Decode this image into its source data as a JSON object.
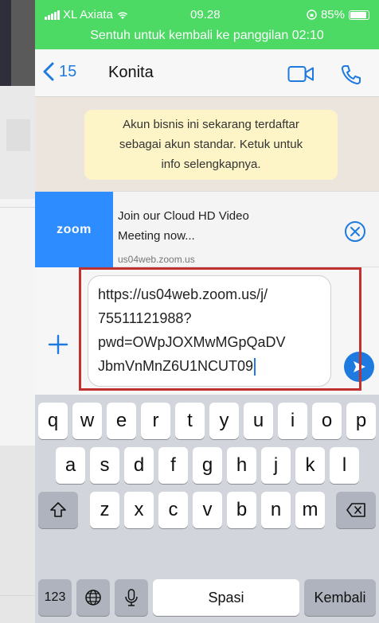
{
  "status_bar": {
    "carrier": "XL Axiata",
    "time": "09.28",
    "battery": "85%",
    "return_banner": "Sentuh untuk kembali ke panggilan 02:10"
  },
  "header": {
    "back_count": "15",
    "contact_name": "Konita",
    "icons": [
      "chevron-left-icon",
      "video-call-icon",
      "phone-call-icon"
    ]
  },
  "chat": {
    "system_message_lines": [
      "Akun bisnis ini sekarang terdaftar",
      "sebagai akun standar. Ketuk untuk",
      "info selengkapnya."
    ]
  },
  "link_preview": {
    "logo_text": "zoom",
    "title_lines": [
      "Join our Cloud HD Video",
      "Meeting now..."
    ],
    "url": "us04web.zoom.us"
  },
  "composer": {
    "text": "https://us04web.zoom.us/j/\n75511121988?\npwd=OWpJOXMwMGpQaDV\nJbmVnMnZ6U1NCUT09"
  },
  "keyboard": {
    "row1": [
      "q",
      "w",
      "e",
      "r",
      "t",
      "y",
      "u",
      "i",
      "o",
      "p"
    ],
    "row2": [
      "a",
      "s",
      "d",
      "f",
      "g",
      "h",
      "j",
      "k",
      "l"
    ],
    "row3": [
      "z",
      "x",
      "c",
      "v",
      "b",
      "n",
      "m"
    ],
    "numbers_key": "123",
    "space_key": "Spasi",
    "return_key": "Kembali"
  },
  "colors": {
    "status_green": "#4cd964",
    "ios_blue": "#1f7ae0",
    "zoom_blue": "#2d8cff",
    "highlight_red": "#c0312f"
  }
}
